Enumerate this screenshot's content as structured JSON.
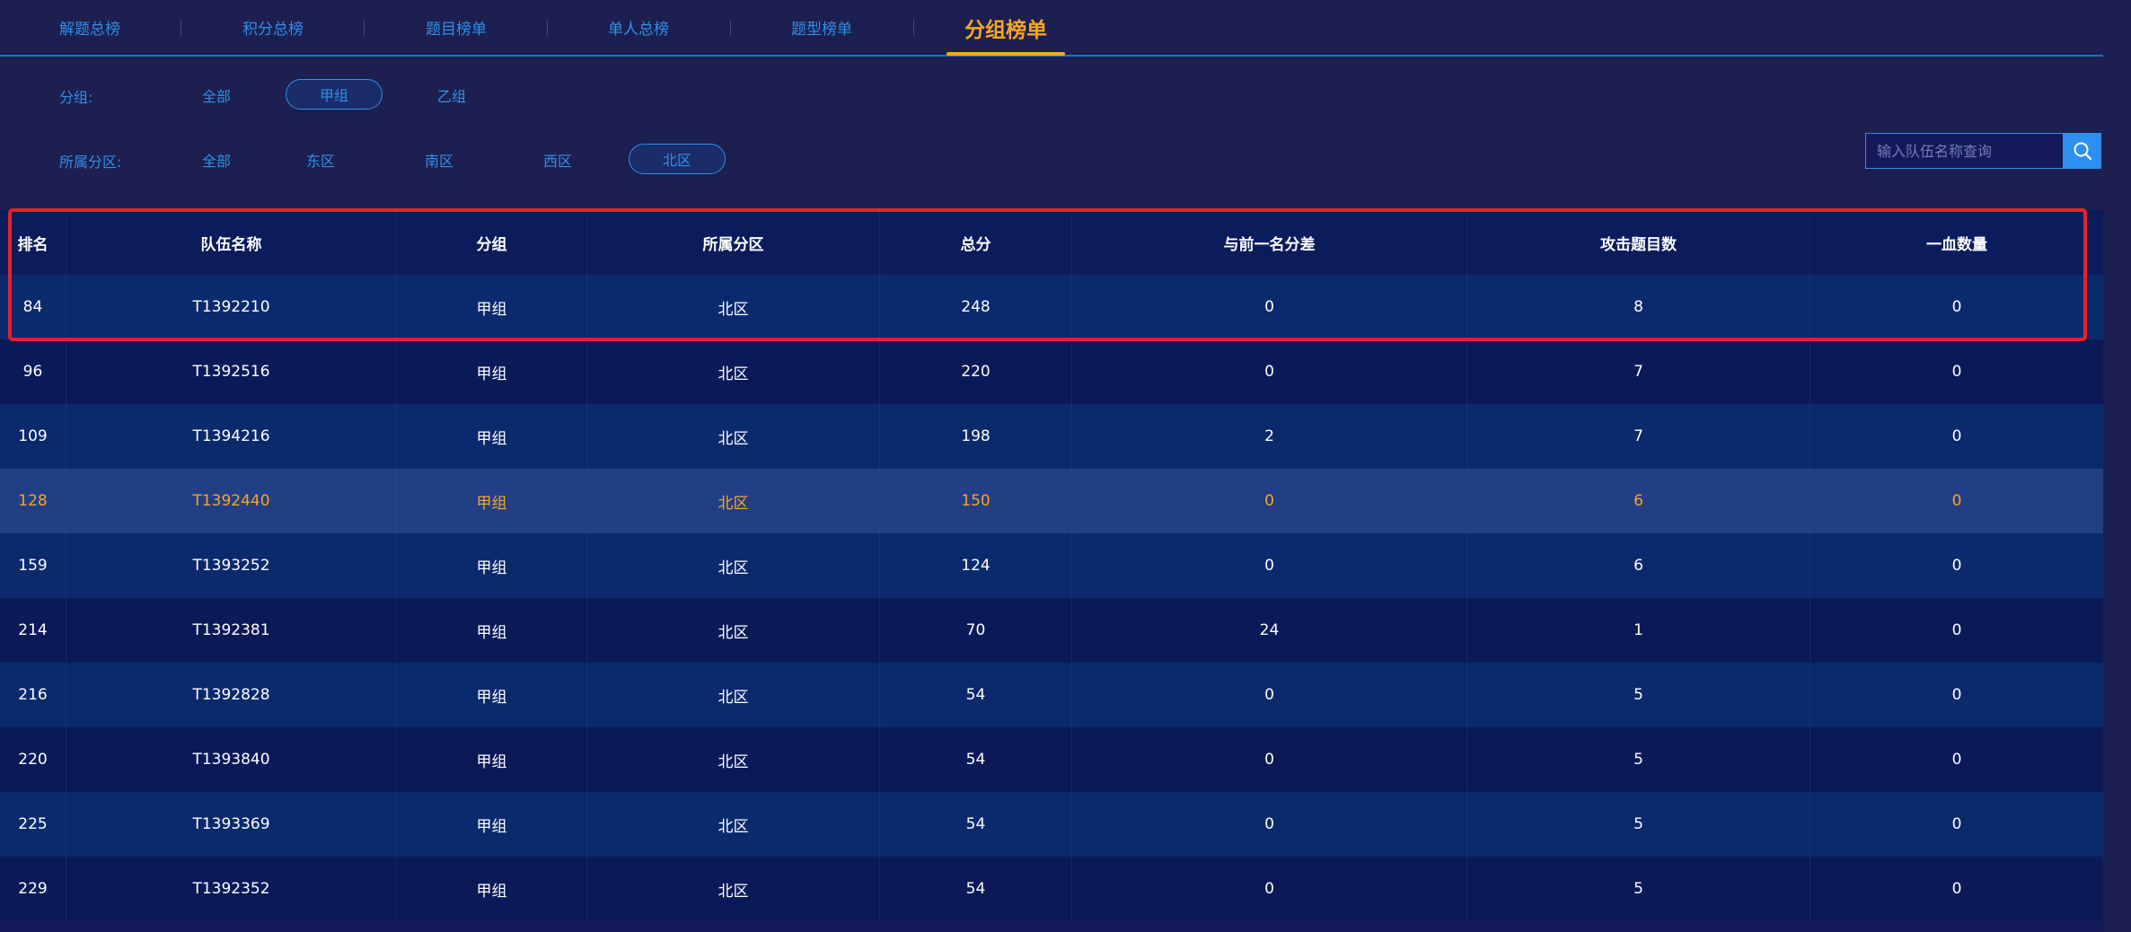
{
  "tabs": [
    {
      "label": "解题总榜",
      "active": false
    },
    {
      "label": "积分总榜",
      "active": false
    },
    {
      "label": "题目榜单",
      "active": false
    },
    {
      "label": "单人总榜",
      "active": false
    },
    {
      "label": "题型榜单",
      "active": false
    },
    {
      "label": "分组榜单",
      "active": true
    }
  ],
  "filters": {
    "group": {
      "label": "分组:",
      "options": [
        "全部",
        "甲组",
        "乙组"
      ],
      "selected": "甲组"
    },
    "region": {
      "label": "所属分区:",
      "options": [
        "全部",
        "东区",
        "南区",
        "西区",
        "北区"
      ],
      "selected": "北区"
    }
  },
  "search": {
    "placeholder": "输入队伍名称查询",
    "value": "",
    "icon": "search-icon"
  },
  "table": {
    "headers": [
      "排名",
      "队伍名称",
      "分组",
      "所属分区",
      "总分",
      "与前一名分差",
      "攻击题目数",
      "一血数量"
    ],
    "rows": [
      [
        "84",
        "T1392210",
        "甲组",
        "北区",
        "248",
        "0",
        "8",
        "0"
      ],
      [
        "96",
        "T1392516",
        "甲组",
        "北区",
        "220",
        "0",
        "7",
        "0"
      ],
      [
        "109",
        "T1394216",
        "甲组",
        "北区",
        "198",
        "2",
        "7",
        "0"
      ],
      [
        "128",
        "T1392440",
        "甲组",
        "北区",
        "150",
        "0",
        "6",
        "0"
      ],
      [
        "159",
        "T1393252",
        "甲组",
        "北区",
        "124",
        "0",
        "6",
        "0"
      ],
      [
        "214",
        "T1392381",
        "甲组",
        "北区",
        "70",
        "24",
        "1",
        "0"
      ],
      [
        "216",
        "T1392828",
        "甲组",
        "北区",
        "54",
        "0",
        "5",
        "0"
      ],
      [
        "220",
        "T1393840",
        "甲组",
        "北区",
        "54",
        "0",
        "5",
        "0"
      ],
      [
        "225",
        "T1393369",
        "甲组",
        "北区",
        "54",
        "0",
        "5",
        "0"
      ],
      [
        "229",
        "T1392352",
        "甲组",
        "北区",
        "54",
        "0",
        "5",
        "0"
      ]
    ],
    "highlighted_row_rank": "128"
  },
  "colors": {
    "background": "#1c1f50",
    "accent_blue": "#2f90e8",
    "active_tab": "#f5a623",
    "highlight_text": "#f5a623",
    "annotation_red": "#e8202a"
  }
}
